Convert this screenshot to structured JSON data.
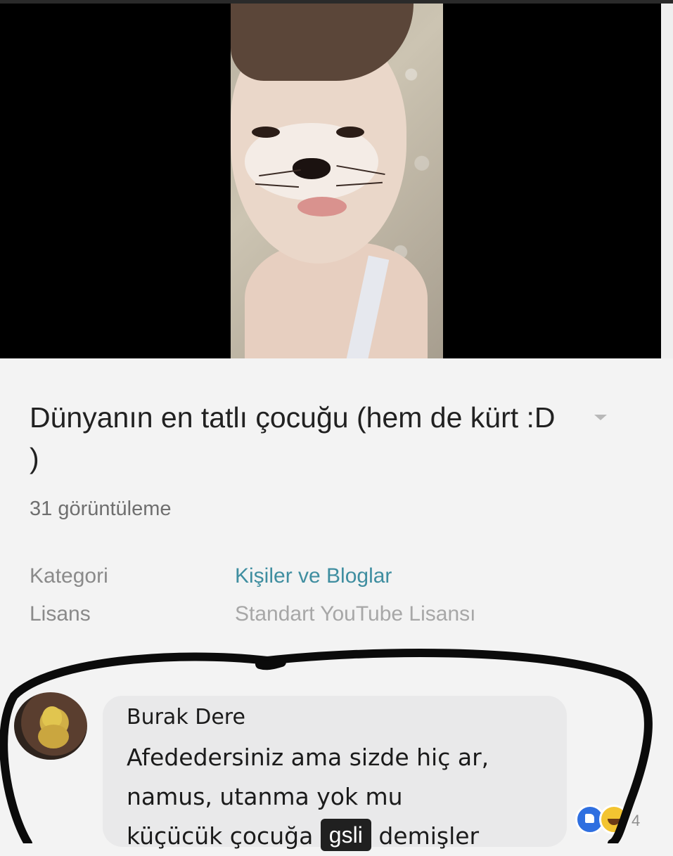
{
  "video": {
    "title": "Dünyanın en tatlı çocuğu (hem de kürt :D )",
    "views": "31 görüntüleme"
  },
  "details": {
    "category_label": "Kategori",
    "category_value": "Kişiler ve Bloglar",
    "license_label": "Lisans",
    "license_value": "Standart YouTube Lisansı"
  },
  "comment": {
    "author": "Burak Dere",
    "line1": "Afededersiniz ama sizde hiç ar,",
    "line2": "namus, utanma yok mu",
    "line3_before": "küçücük çocuğa",
    "line3_after": "demişler",
    "reaction_count": "4"
  },
  "watermark": "gsli",
  "colors": {
    "link": "#3f8ea0",
    "like": "#2f6fe0",
    "haha": "#f3c431",
    "bubble": "#e9e9ea"
  },
  "icons": [
    "dropdown-arrow-icon",
    "like-reaction-icon",
    "haha-reaction-icon"
  ]
}
